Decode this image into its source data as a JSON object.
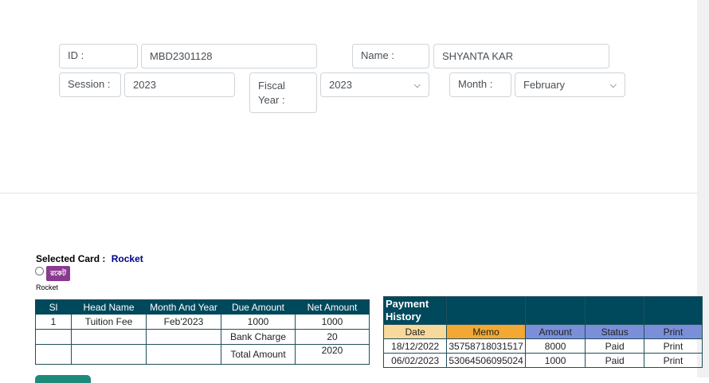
{
  "form": {
    "id_label": "ID :",
    "id_value": "MBD2301128",
    "name_label": "Name :",
    "name_value": "SHYANTA KAR",
    "session_label": "Session :",
    "session_value": "2023",
    "fiscal_year_label": "Fiscal Year :",
    "fiscal_year_value": "2023",
    "month_label": "Month :",
    "month_value": "February"
  },
  "payment": {
    "selected_card_label": "Selected Card :",
    "selected_card_value": "Rocket",
    "rocket_logo_text": "রকেট",
    "rocket_caption": "Rocket"
  },
  "fee_table": {
    "headers": [
      "Sl",
      "Head Name",
      "Month And Year",
      "Due Amount",
      "Net Amount"
    ],
    "row": {
      "sl": "1",
      "head": "Tuition Fee",
      "month": "Feb'2023",
      "due": "1000",
      "net": "1000"
    },
    "bank_charge_label": "Bank Charge",
    "bank_charge_value": "20",
    "total_label": "Total Amount",
    "total_value": "2020"
  },
  "history": {
    "title": "Payment History",
    "headers": [
      "Date",
      "Memo",
      "Amount",
      "Status",
      "Print"
    ],
    "header_colors": [
      "#f8d99c",
      "#f2a832",
      "#7b8fd8",
      "#7b8fd8",
      "#7b8fd8"
    ],
    "rows": [
      {
        "date": "18/12/2022",
        "memo": "35758718031517",
        "amount": "8000",
        "status": "Paid",
        "print": "Print"
      },
      {
        "date": "06/02/2023",
        "memo": "53064506095024",
        "amount": "1000",
        "status": "Paid",
        "print": "Print"
      }
    ]
  },
  "colors": {
    "table_header": "#00495c",
    "link": "#1a6fc2",
    "card_value": "#00008b"
  }
}
